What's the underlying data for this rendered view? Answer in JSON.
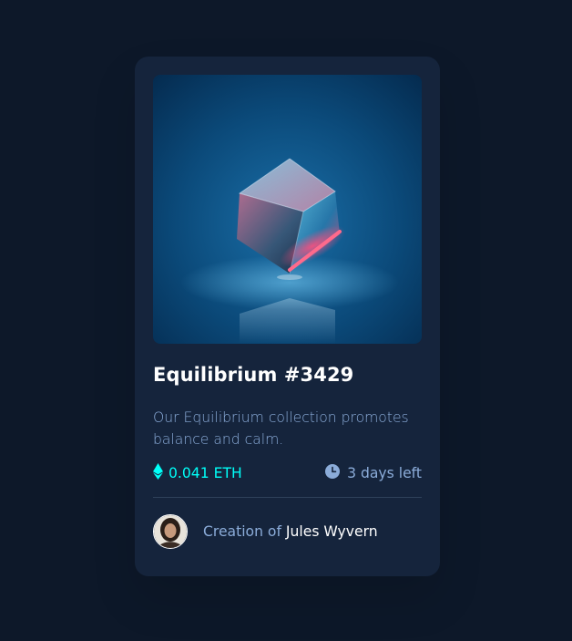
{
  "card": {
    "image_alt": "equilibrium-cube-art",
    "title": "Equilibrium #3429",
    "description": "Our Equilibrium collection promotes balance and calm.",
    "price": "0.041 ETH",
    "time_left": "3 days left",
    "creator_prefix": "Creation of ",
    "creator_name": "Jules Wyvern"
  },
  "icons": {
    "price": "ethereum-icon",
    "time": "clock-icon"
  },
  "colors": {
    "page_bg": "#0d1829",
    "card_bg": "#15243c",
    "accent_cyan": "#00fff8",
    "soft_blue": "#8bacd9",
    "white": "#ffffff",
    "divider": "#2e405a"
  }
}
